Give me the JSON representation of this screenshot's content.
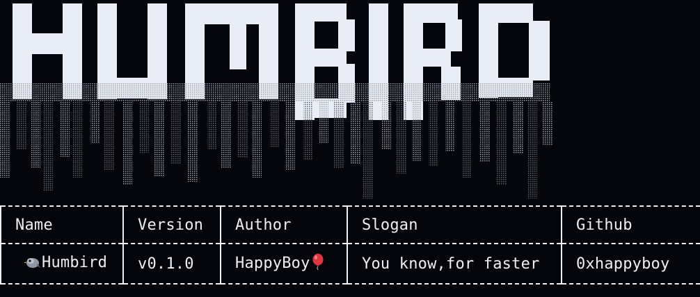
{
  "banner": {
    "title": "HUMBIRD",
    "colors": {
      "fill": "#e9edf5",
      "shade": "#a4abb8",
      "drip_light": "#7c828e",
      "drip_dark": "#4b505a",
      "background": "#04060c"
    }
  },
  "table": {
    "headers": [
      "Name",
      "Version",
      "Author",
      "Slogan",
      "Github"
    ],
    "row": {
      "name": "Humbird",
      "name_icon": "bird-icon",
      "version": "v0.1.0",
      "author": "HappyBoy",
      "author_icon": "balloon-icon",
      "slogan": "You know,for faster",
      "github": "0xhappyboy"
    },
    "border_color": "#eef0f6"
  }
}
